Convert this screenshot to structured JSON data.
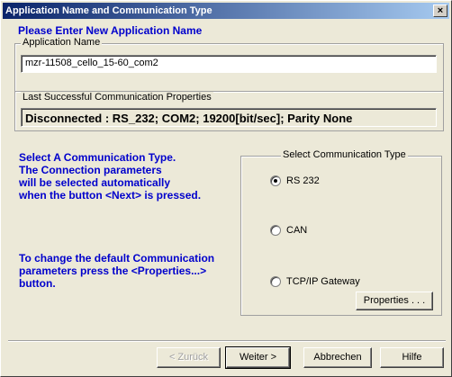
{
  "window": {
    "title": "Application Name and Communication Type",
    "close_label": "×"
  },
  "app_name_section": {
    "heading": "Please Enter New Application Name",
    "group_label": "Application Name",
    "input_value": "mzr-11508_cello_15-60_com2"
  },
  "last_comm": {
    "group_label": "Last Successful Communication  Properties",
    "status": "Disconnected : RS_232; COM2; 19200[bit/sec]; Parity None"
  },
  "instructions": {
    "line1": "Select A Communication Type.",
    "line2": "The Connection parameters",
    "line3": "will be selected automatically",
    "line4": "when the button <Next> is pressed.",
    "line5": "To change the default Communication",
    "line6": "parameters press the <Properties...>",
    "line7": "button."
  },
  "comm_type": {
    "group_label": "Select Communication Type",
    "options": [
      {
        "label": "RS 232",
        "checked": true
      },
      {
        "label": "CAN",
        "checked": false
      },
      {
        "label": "TCP/IP Gateway",
        "checked": false
      }
    ],
    "properties_label": "Properties . . ."
  },
  "footer": {
    "back_label": "< Zurück",
    "next_label": "Weiter >",
    "cancel_label": "Abbrechen",
    "help_label": "Hilfe"
  }
}
